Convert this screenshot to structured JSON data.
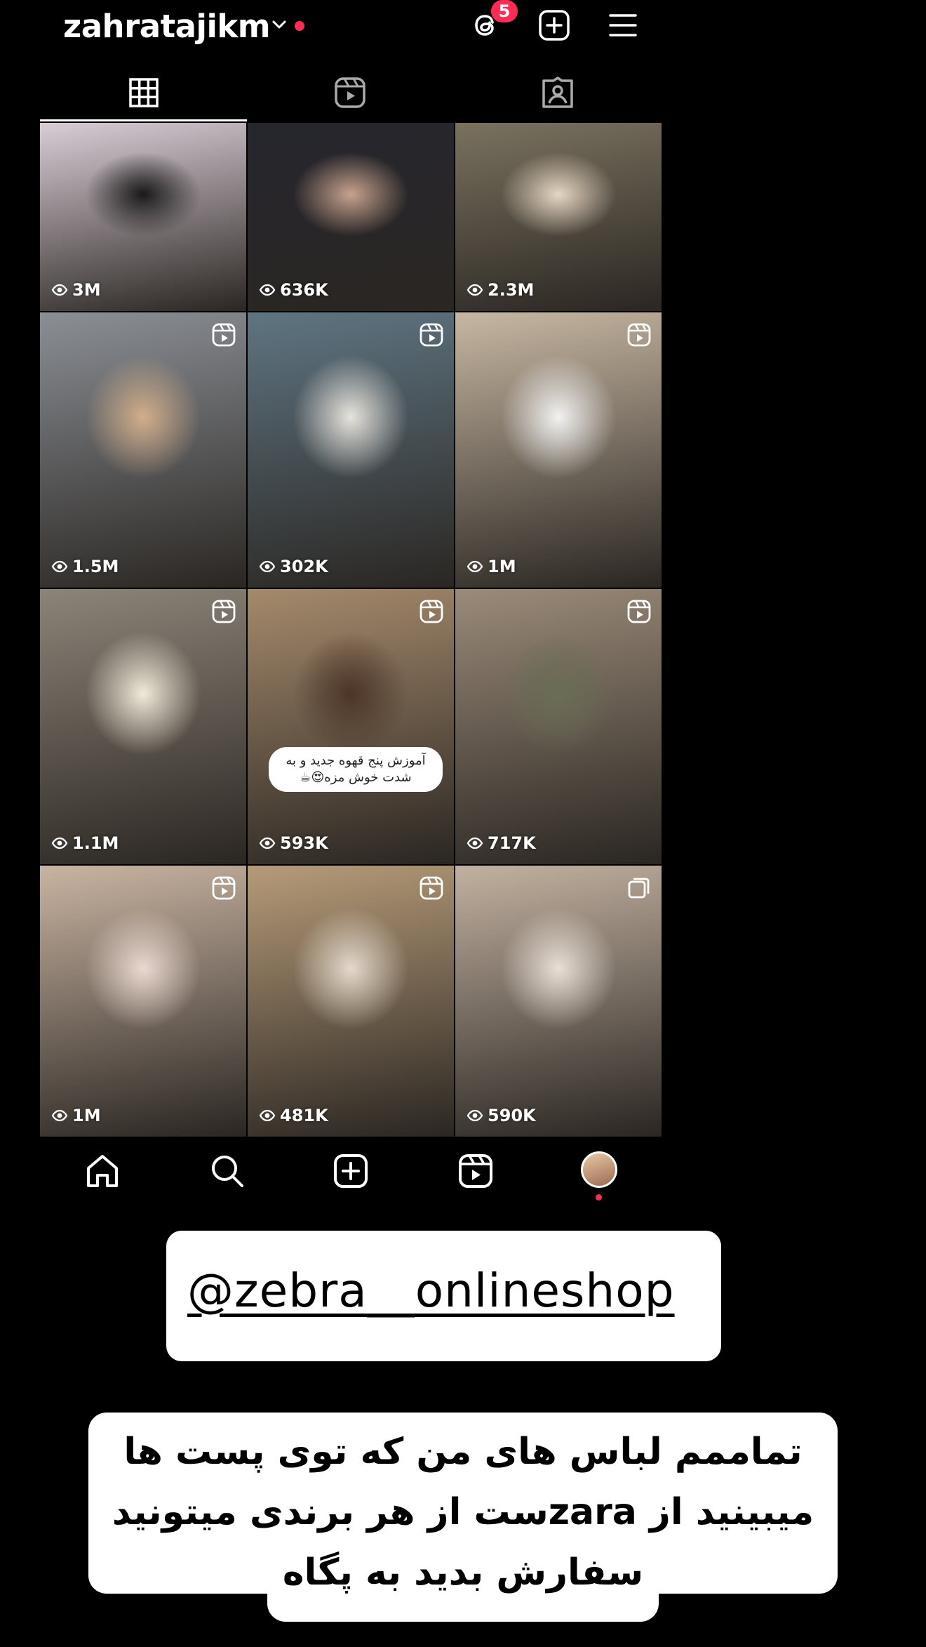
{
  "profile": {
    "username": "zahratajikm",
    "threads_badge": "5"
  },
  "icons": {
    "header": [
      "chevron-down-icon",
      "threads-icon",
      "add-post-icon",
      "menu-icon"
    ],
    "tabs": [
      "posts-grid-icon",
      "reels-icon",
      "tagged-icon"
    ],
    "bottom_nav": [
      "home-icon",
      "search-icon",
      "create-icon",
      "reels-icon",
      "profile-avatar"
    ]
  },
  "posts": [
    {
      "views": "3M",
      "type": "post",
      "color": "#d9cdd6",
      "accent": "#1a1a1a"
    },
    {
      "views": "636K",
      "type": "post",
      "color": "#26262e",
      "accent": "#c7a28d"
    },
    {
      "views": "2.3M",
      "type": "post",
      "color": "#7a725f",
      "accent": "#e6d6c3"
    },
    {
      "views": "1.5M",
      "type": "reel",
      "color": "#8b8f95",
      "accent": "#d2ae8a"
    },
    {
      "views": "302K",
      "type": "reel",
      "color": "#5f7582",
      "accent": "#e7e3dc"
    },
    {
      "views": "1M",
      "type": "reel",
      "color": "#c7b7a2",
      "accent": "#f2f2f2"
    },
    {
      "views": "1.1M",
      "type": "reel",
      "color": "#8c8478",
      "accent": "#f0ead9"
    },
    {
      "views": "593K",
      "type": "reel",
      "color": "#a58a6c",
      "accent": "#4b3528",
      "caption": "آموزش پنج قهوه جدید و به شدت خوش مزه😍☕"
    },
    {
      "views": "717K",
      "type": "reel",
      "color": "#9b8b79",
      "accent": "#6a6d55"
    },
    {
      "views": "1M",
      "type": "reel",
      "color": "#c9b4a2",
      "accent": "#ead9d0"
    },
    {
      "views": "481K",
      "type": "reel",
      "color": "#b69b78",
      "accent": "#e4d9cc"
    },
    {
      "views": "590K",
      "type": "carousel",
      "color": "#c2b1a0",
      "accent": "#e9dfd6"
    }
  ],
  "promo": {
    "shop_handle": "@zebra__onlineshop",
    "note": "تماممم لباس های من که توی پست ها میبینید از zaraست از هر برندی میتونید سفارش بدید به پگاه"
  },
  "colors": {
    "background": "#000000",
    "notification": "#ff2d55",
    "card": "#ffffff"
  }
}
